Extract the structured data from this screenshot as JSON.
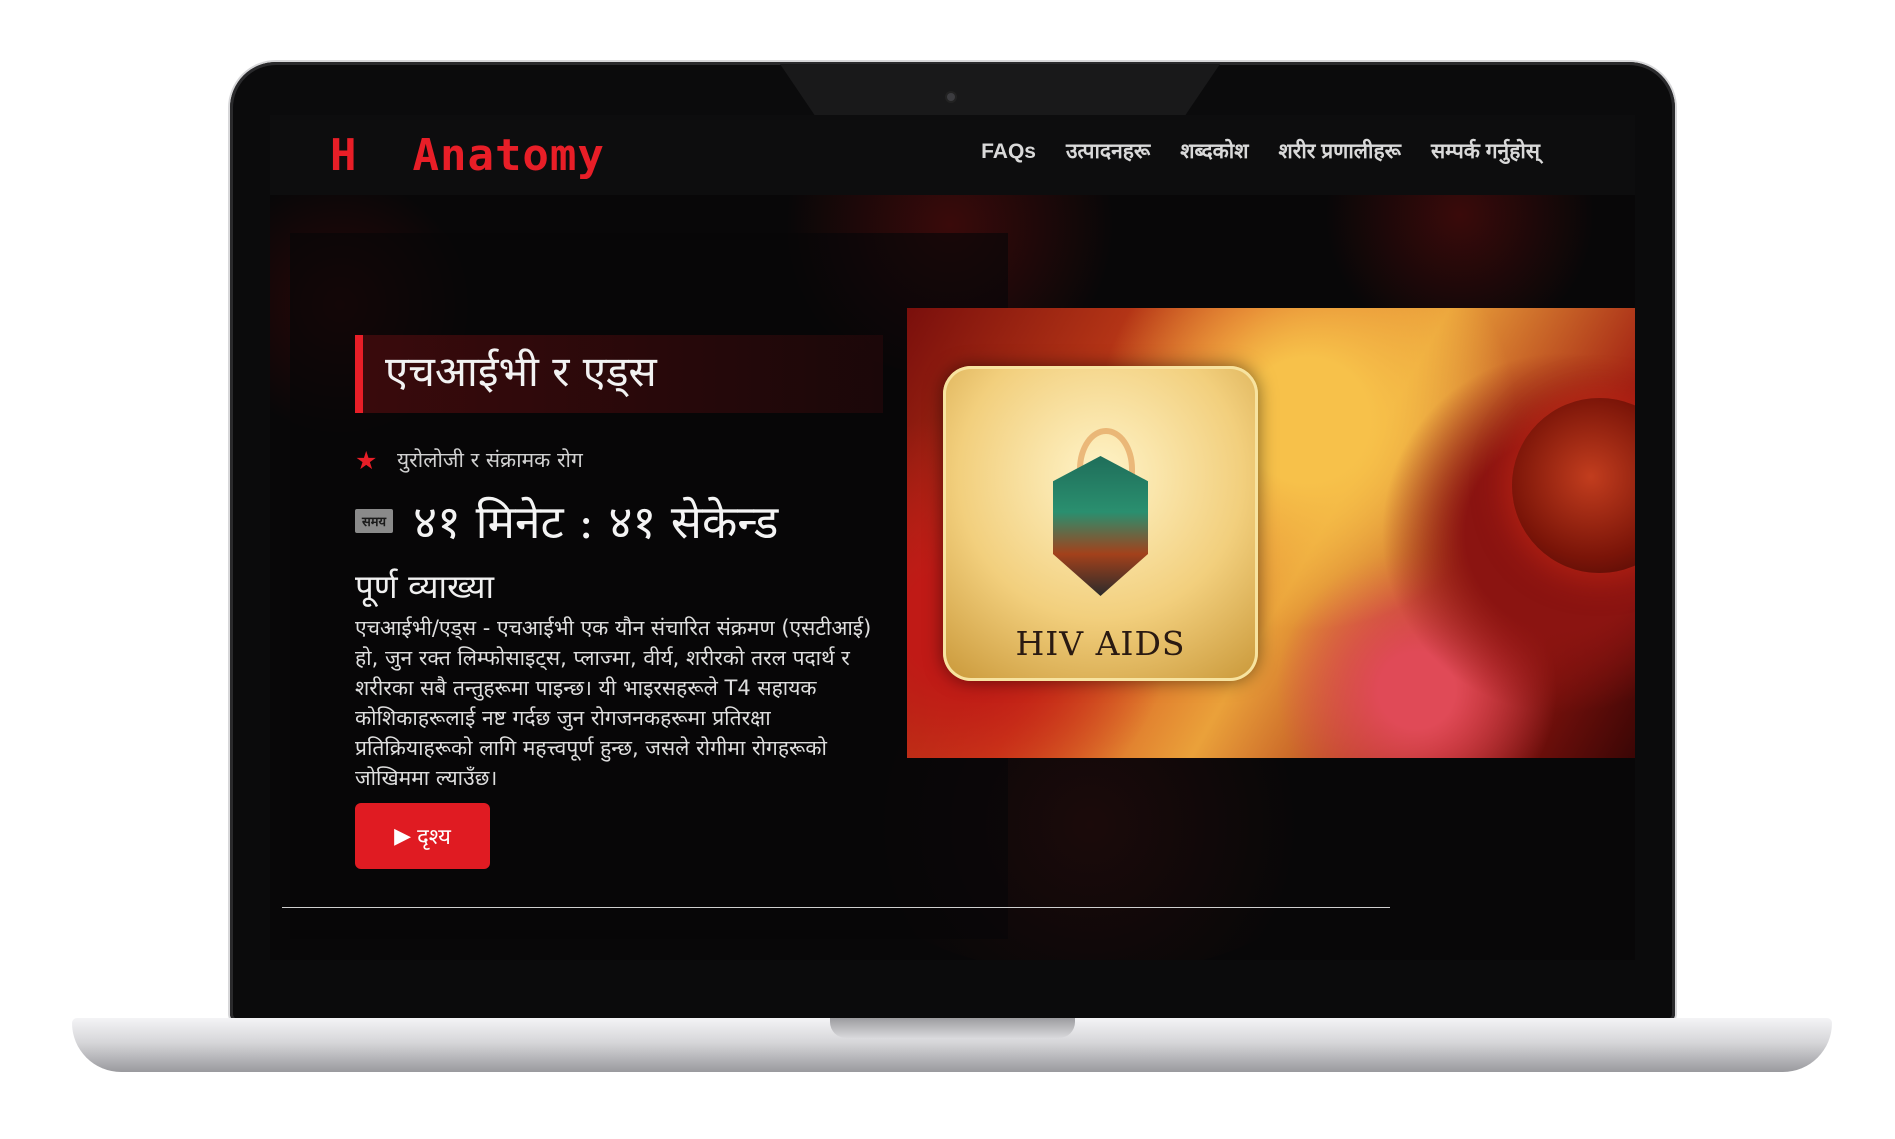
{
  "brand": {
    "logo_text": "H  Anatomy",
    "accent_color": "#e81e27"
  },
  "nav": {
    "items": [
      {
        "label": "FAQs"
      },
      {
        "label": "उत्पादनहरू"
      },
      {
        "label": "शब्दकोश"
      },
      {
        "label": "शरीर प्रणालीहरू"
      },
      {
        "label": "सम्पर्क गर्नुहोस्"
      }
    ]
  },
  "topic": {
    "title": "एचआईभी र एड्स",
    "category": "युरोलोजी र संक्रामक रोग",
    "category_icon": "star-icon",
    "time_badge": "समय",
    "time_value": "४१ मिनेट : ४१ सेकेन्ड",
    "description_title": "पूर्ण व्याख्या",
    "description": "एचआईभी/एड्स - एचआईभी एक यौन संचारित संक्रमण (एसटीआई) हो, जुन रक्त लिम्फोसाइट्स, प्लाज्मा, वीर्य, शरीरको तरल पदार्थ र शरीरका सबै तन्तुहरूमा पाइन्छ। यी भाइरसहरूले T4 सहायक कोशिकाहरूलाई नष्ट गर्दछ जुन रोगजनकहरूमा प्रतिरक्षा प्रतिक्रियाहरूको लागि महत्त्वपूर्ण हुन्छ, जसले रोगीमा रोगहरूको जोखिममा ल्याउँछ।",
    "view_button_label": "दृश्य",
    "view_button_icon": "play-icon",
    "image_caption": "HIV AIDS"
  }
}
